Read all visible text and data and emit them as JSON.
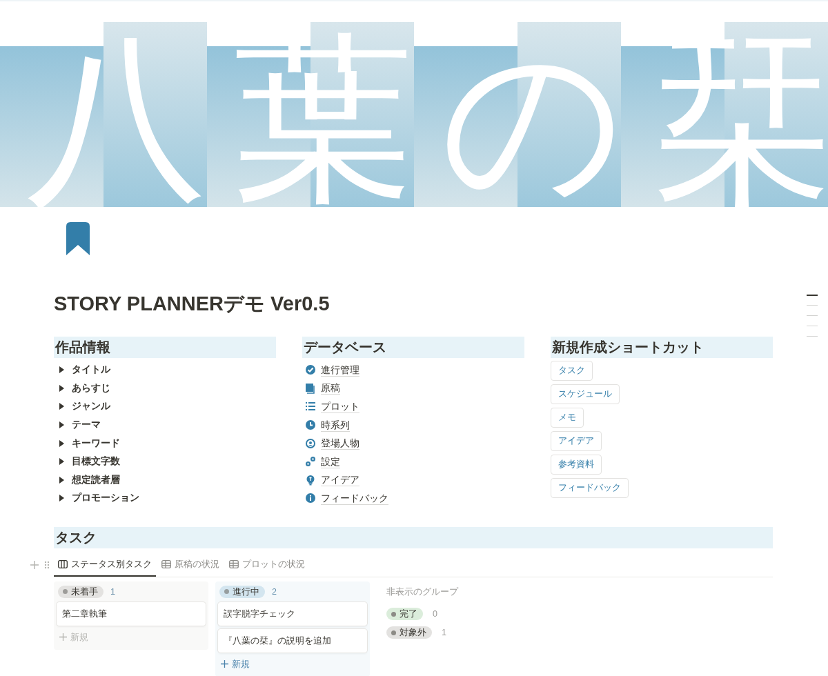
{
  "cover": {
    "title": "八葉の栞"
  },
  "page": {
    "title": "STORY PLANNERデモ Ver0.5"
  },
  "work_info": {
    "heading": "作品情報",
    "items": [
      {
        "label": "タイトル",
        "expanded": false
      },
      {
        "label": "あらすじ",
        "expanded": false
      },
      {
        "label": "ジャンル",
        "expanded": false
      },
      {
        "label": "テーマ",
        "expanded": false
      },
      {
        "label": "キーワード",
        "expanded": false
      },
      {
        "label": "目標文字数",
        "expanded": false
      },
      {
        "label": "想定読者層",
        "expanded": false
      },
      {
        "label": "プロモーション",
        "expanded": false
      }
    ]
  },
  "databases": {
    "heading": "データベース",
    "items": [
      {
        "label": "進行管理"
      },
      {
        "label": "原稿"
      },
      {
        "label": "プロット"
      },
      {
        "label": "時系列"
      },
      {
        "label": "登場人物"
      },
      {
        "label": "設定"
      },
      {
        "label": "アイデア"
      },
      {
        "label": "フィードバック"
      }
    ]
  },
  "shortcuts": {
    "heading": "新規作成ショートカット",
    "buttons": [
      "タスク",
      "スケジュール",
      "メモ",
      "アイデア",
      "参考資料",
      "フィードバック"
    ]
  },
  "tasks": {
    "heading": "タスク",
    "tabs": [
      {
        "label": "ステータス別タスク",
        "kind": "board",
        "selected": true
      },
      {
        "label": "原稿の状況",
        "kind": "table",
        "selected": false
      },
      {
        "label": "プロットの状況",
        "kind": "table",
        "selected": false
      }
    ],
    "columns": [
      {
        "status": "未着手",
        "count": "1",
        "color": "#e3e2e0",
        "cards": [
          "第二章執筆"
        ],
        "new_label": "新規"
      },
      {
        "status": "進行中",
        "count": "2",
        "color": "#d3e5ef",
        "cards": [
          "誤字脱字チェック",
          "『八葉の栞』の説明を追加"
        ],
        "new_label": "新規"
      }
    ],
    "hidden": {
      "heading": "非表示のグループ",
      "groups": [
        {
          "status": "完了",
          "count": "0",
          "color": "#dbeddb"
        },
        {
          "status": "対象外",
          "count": "1",
          "color": "#e3e2e0"
        }
      ]
    }
  }
}
